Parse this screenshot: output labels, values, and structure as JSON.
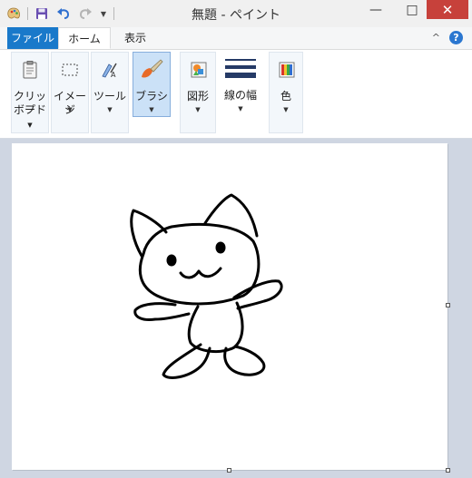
{
  "window": {
    "title": "無題 - ペイント",
    "minimize": "—",
    "maximize": "□",
    "close": "✕"
  },
  "tabs": [
    {
      "label": "ファイル"
    },
    {
      "label": "ホーム"
    },
    {
      "label": "表示"
    }
  ],
  "help": {
    "label": "?",
    "collapse": "^"
  },
  "ribbon": {
    "clipboard": {
      "line1": "クリップ",
      "line2": "ボード",
      "arrow": "▼"
    },
    "image": {
      "label": "イメージ",
      "arrow": "▼"
    },
    "tools": {
      "label": "ツール",
      "arrow": "▼"
    },
    "brushes": {
      "label": "ブラシ",
      "arrow": "▼"
    },
    "shapes": {
      "label": "図形",
      "arrow": "▼"
    },
    "size": {
      "label": "線の幅",
      "arrow": "▼"
    },
    "colors": {
      "label": "色",
      "arrow": "▼"
    }
  },
  "colors": {
    "file_tab": "#1979ca",
    "close_btn": "#c7413b",
    "active_group": "#cbe1f7"
  }
}
